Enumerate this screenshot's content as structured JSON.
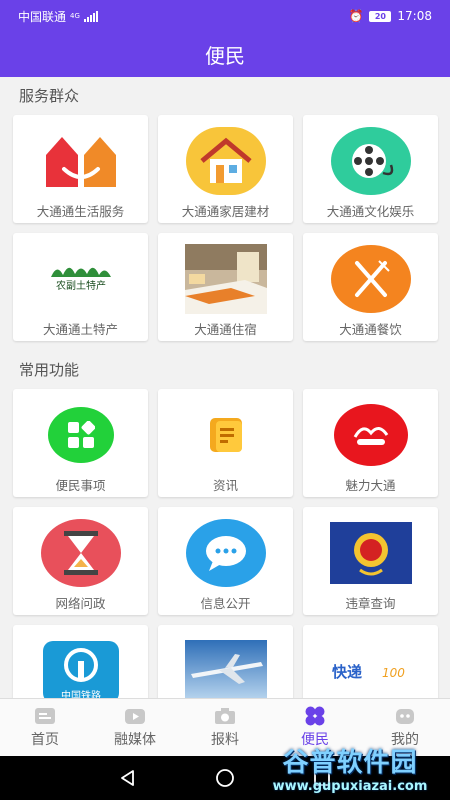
{
  "status": {
    "carrier": "中国联通",
    "network": "4G",
    "battery": "20",
    "time": "17:08"
  },
  "appbar": {
    "title": "便民"
  },
  "sections": [
    {
      "title": "服务群众",
      "items": [
        {
          "label": "大通通生活服务",
          "icon": "house-smile-icon"
        },
        {
          "label": "大通通家居建材",
          "icon": "home-icon"
        },
        {
          "label": "大通通文化娱乐",
          "icon": "film-reel-icon"
        },
        {
          "label": "大通通土特产",
          "icon": "farm-produce-icon"
        },
        {
          "label": "大通通住宿",
          "icon": "hotel-room-icon"
        },
        {
          "label": "大通通餐饮",
          "icon": "fork-knife-icon"
        }
      ]
    },
    {
      "title": "常用功能",
      "items": [
        {
          "label": "便民事项",
          "icon": "grid-apps-icon"
        },
        {
          "label": "资讯",
          "icon": "news-icon"
        },
        {
          "label": "魅力大通",
          "icon": "charm-icon"
        },
        {
          "label": "网络问政",
          "icon": "hourglass-icon"
        },
        {
          "label": "信息公开",
          "icon": "speech-bubble-icon"
        },
        {
          "label": "违章查询",
          "icon": "police-emblem-icon"
        },
        {
          "label": "",
          "icon": "railway-icon"
        },
        {
          "label": "",
          "icon": "airplane-icon"
        },
        {
          "label": "",
          "icon": "express-icon"
        }
      ]
    }
  ],
  "icon_text": {
    "farm": "农副土特产",
    "railway": "中国铁路",
    "express_a": "快递",
    "express_b": "100"
  },
  "tabs": [
    {
      "label": "首页",
      "icon": "home-tab-icon"
    },
    {
      "label": "融媒体",
      "icon": "play-tab-icon"
    },
    {
      "label": "报料",
      "icon": "camera-tab-icon"
    },
    {
      "label": "便民",
      "icon": "clover-tab-icon"
    },
    {
      "label": "我的",
      "icon": "profile-tab-icon"
    }
  ],
  "watermark": {
    "line1": "谷普软件园",
    "line2": "www.gupuxiazai.com"
  },
  "colors": {
    "primary": "#6a41e8",
    "background": "#f2f2f2"
  }
}
